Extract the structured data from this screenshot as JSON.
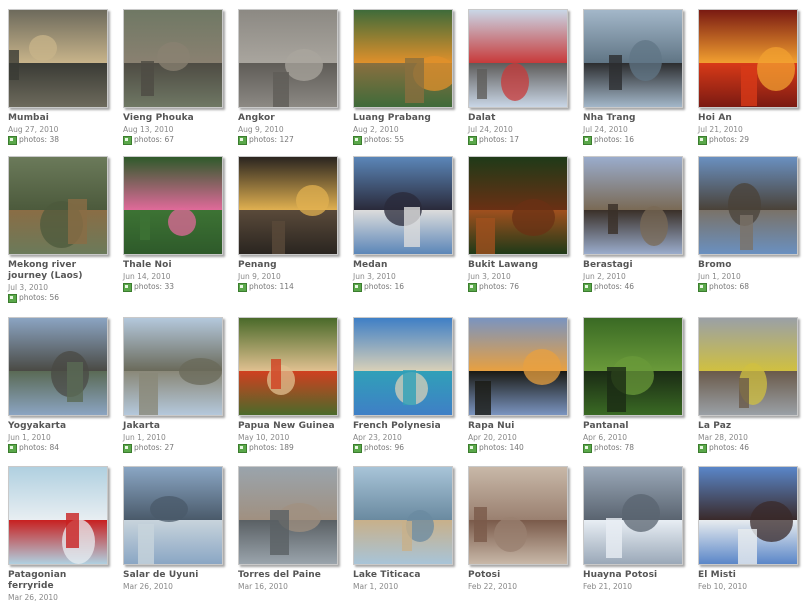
{
  "albums": [
    {
      "title": "Mumbai",
      "date": "Aug 27, 2010",
      "count_label": "photos: 38",
      "colors": [
        "#6d6a5c",
        "#3a3b35",
        "#c8b48a"
      ]
    },
    {
      "title": "Vieng Phouka",
      "date": "Aug 13, 2010",
      "count_label": "photos: 67",
      "colors": [
        "#6f7864",
        "#4e4b43",
        "#8a8171"
      ]
    },
    {
      "title": "Angkor",
      "date": "Aug 9, 2010",
      "count_label": "photos: 127",
      "colors": [
        "#8c8983",
        "#5f5c57",
        "#a9a59e"
      ]
    },
    {
      "title": "Luang Prabang",
      "date": "Aug 2, 2010",
      "count_label": "photos: 55",
      "colors": [
        "#3f6b3a",
        "#8a6f3f",
        "#e0902b"
      ]
    },
    {
      "title": "Dalat",
      "date": "Jul 24, 2010",
      "count_label": "photos: 17",
      "colors": [
        "#c9d6e6",
        "#5e5c5a",
        "#c83a3a"
      ]
    },
    {
      "title": "Nha Trang",
      "date": "Jul 24, 2010",
      "count_label": "photos: 16",
      "colors": [
        "#a3b7c9",
        "#2c2d2f",
        "#607585"
      ]
    },
    {
      "title": "Hoi An",
      "date": "Jul 21, 2010",
      "count_label": "photos: 29",
      "colors": [
        "#7a1a12",
        "#d83a18",
        "#f2a030"
      ]
    },
    {
      "title": "Mekong river journey (Laos)",
      "date": "Jul 3, 2010",
      "count_label": "photos: 56",
      "colors": [
        "#6b7a5a",
        "#8a6d45",
        "#4c5a3c"
      ]
    },
    {
      "title": "Thale Noi",
      "date": "Jun 14, 2010",
      "count_label": "photos: 33",
      "colors": [
        "#2e5a2a",
        "#3d7334",
        "#e06a9a"
      ]
    },
    {
      "title": "Penang",
      "date": "Jun 9, 2010",
      "count_label": "photos: 114",
      "colors": [
        "#2a2520",
        "#5a4a3a",
        "#e0b050"
      ]
    },
    {
      "title": "Medan",
      "date": "Jun 3, 2010",
      "count_label": "photos: 16",
      "colors": [
        "#5b86b8",
        "#dcdcdc",
        "#2a2a3a"
      ]
    },
    {
      "title": "Bukit Lawang",
      "date": "Jun 3, 2010",
      "count_label": "photos: 76",
      "colors": [
        "#1f3a18",
        "#a0501e",
        "#6a3014"
      ]
    },
    {
      "title": "Berastagi",
      "date": "Jun 2, 2010",
      "count_label": "photos: 46",
      "colors": [
        "#9aaccc",
        "#3a3028",
        "#7a6a55"
      ]
    },
    {
      "title": "Bromo",
      "date": "Jun 1, 2010",
      "count_label": "photos: 68",
      "colors": [
        "#6a90c0",
        "#7a7268",
        "#4a4238"
      ]
    },
    {
      "title": "Yogyakarta",
      "date": "Jun 1, 2010",
      "count_label": "photos: 84",
      "colors": [
        "#8ba4c2",
        "#5a6a55",
        "#4a4a44"
      ]
    },
    {
      "title": "Jakarta",
      "date": "Jun 1, 2010",
      "count_label": "photos: 27",
      "colors": [
        "#b4c8dc",
        "#8a8878",
        "#6a6a5a"
      ]
    },
    {
      "title": "Papua New Guinea",
      "date": "May 10, 2010",
      "count_label": "photos: 189",
      "colors": [
        "#4a6a2a",
        "#d04020",
        "#e0c090"
      ]
    },
    {
      "title": "French Polynesia",
      "date": "Apr 23, 2010",
      "count_label": "photos: 96",
      "colors": [
        "#3f7fc6",
        "#30a0b8",
        "#d8d0b8"
      ]
    },
    {
      "title": "Rapa Nui",
      "date": "Apr 20, 2010",
      "count_label": "photos: 140",
      "colors": [
        "#7a94c0",
        "#1a1a14",
        "#e8a040"
      ]
    },
    {
      "title": "Pantanal",
      "date": "Apr 6, 2010",
      "count_label": "photos: 78",
      "colors": [
        "#3a6a24",
        "#1a2a14",
        "#6a9a3a"
      ]
    },
    {
      "title": "La Paz",
      "date": "Mar 28, 2010",
      "count_label": "photos: 46",
      "colors": [
        "#9aa0a6",
        "#6a5a4a",
        "#d0c040"
      ]
    },
    {
      "title": "Patagonian ferryride",
      "date": "Mar 26, 2010",
      "count_label": "",
      "colors": [
        "#b0d0e0",
        "#c82020",
        "#e8eef2"
      ]
    },
    {
      "title": "Salar de Uyuni",
      "date": "Mar 26, 2010",
      "count_label": "",
      "colors": [
        "#8aa6c4",
        "#c8d4dc",
        "#4a5a6a"
      ]
    },
    {
      "title": "Torres del Paine",
      "date": "Mar 16, 2010",
      "count_label": "",
      "colors": [
        "#9aa4ac",
        "#5a6064",
        "#a09080"
      ]
    },
    {
      "title": "Lake Titicaca",
      "date": "Mar 1, 2010",
      "count_label": "",
      "colors": [
        "#a8c4d8",
        "#c8b08a",
        "#6a8aa0"
      ]
    },
    {
      "title": "Potosi",
      "date": "Feb 22, 2010",
      "count_label": "",
      "colors": [
        "#c8b8a8",
        "#7a5a4a",
        "#9a8070"
      ]
    },
    {
      "title": "Huayna Potosi",
      "date": "Feb 21, 2010",
      "count_label": "",
      "colors": [
        "#9aa8b8",
        "#e8eef4",
        "#5a6470"
      ]
    },
    {
      "title": "El Misti",
      "date": "Feb 10, 2010",
      "count_label": "",
      "colors": [
        "#5a86c8",
        "#e8ecef",
        "#3a2a2a"
      ]
    }
  ]
}
